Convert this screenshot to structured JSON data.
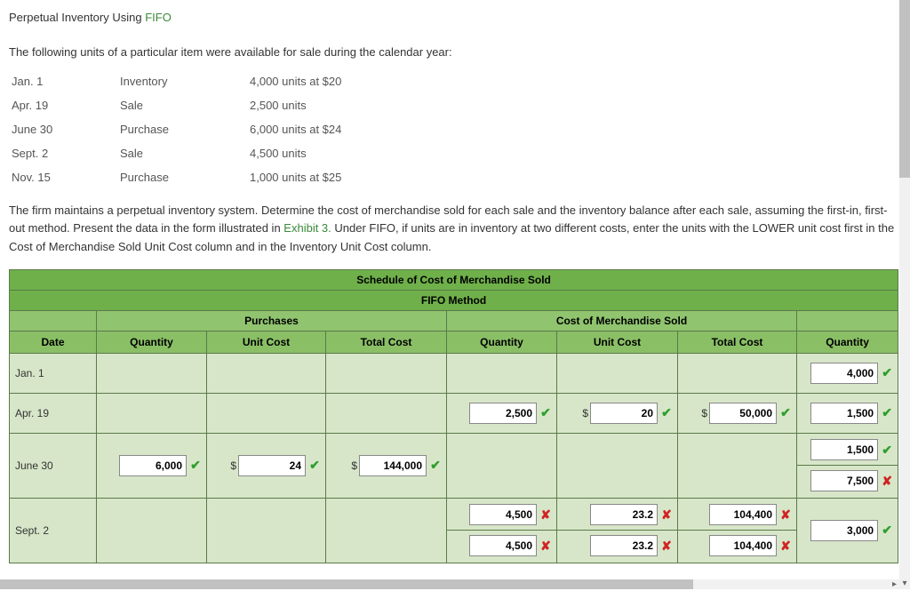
{
  "header": {
    "title_prefix": "Perpetual Inventory Using ",
    "title_link": "FIFO"
  },
  "intro": "The following units of a particular item were available for sale during the calendar year:",
  "transactions": [
    {
      "date": "Jan. 1",
      "type": "Inventory",
      "desc": "4,000 units at $20"
    },
    {
      "date": "Apr. 19",
      "type": "Sale",
      "desc": "2,500 units"
    },
    {
      "date": "June 30",
      "type": "Purchase",
      "desc": "6,000 units at $24"
    },
    {
      "date": "Sept. 2",
      "type": "Sale",
      "desc": "4,500 units"
    },
    {
      "date": "Nov. 15",
      "type": "Purchase",
      "desc": "1,000 units at $25"
    }
  ],
  "instr": {
    "p1a": "The firm maintains a perpetual inventory system. Determine the cost of merchandise sold for each sale and the inventory balance after each sale, assuming the first-in, first-out method. Present the data in the form illustrated in ",
    "link": "Exhibit 3.",
    "p1b": " Under FIFO, if units are in inventory at two different costs, enter the units with the LOWER unit cost first in the Cost of Merchandise Sold Unit Cost column and in the Inventory Unit Cost column."
  },
  "ws": {
    "title": "Schedule of Cost of Merchandise Sold",
    "subtitle": "FIFO Method",
    "grp_purchases": "Purchases",
    "grp_cogs": "Cost of Merchandise Sold",
    "cols": {
      "date": "Date",
      "qty": "Quantity",
      "uc": "Unit Cost",
      "tc": "Total Cost",
      "qty2": "Quantity",
      "uc2": "Unit Cost",
      "tc2": "Total Cost",
      "qty3": "Quantity"
    },
    "rows": {
      "r0": {
        "date": "Jan. 1",
        "inv_q": "4,000",
        "inv_q_ok": true
      },
      "r1": {
        "date": "Apr. 19",
        "cq": "2,500",
        "cq_ok": true,
        "cuc": "20",
        "cuc_ok": true,
        "ctc": "50,000",
        "ctc_ok": true,
        "inv_q": "1,500",
        "inv_q_ok": true
      },
      "r2": {
        "date": "June 30",
        "pq": "6,000",
        "pq_ok": true,
        "puc": "24",
        "puc_ok": true,
        "ptc": "144,000",
        "ptc_ok": true,
        "inv_a_q": "1,500",
        "inv_a_ok": true,
        "inv_b_q": "7,500",
        "inv_b_ok": false
      },
      "r3": {
        "date": "Sept. 2",
        "a": {
          "cq": "4,500",
          "cq_ok": false,
          "cuc": "23.2",
          "cuc_ok": false,
          "ctc": "104,400",
          "ctc_ok": false
        },
        "b": {
          "cq": "4,500",
          "cq_ok": false,
          "cuc": "23.2",
          "cuc_ok": false,
          "ctc": "104,400",
          "ctc_ok": false
        },
        "inv_q": "3,000",
        "inv_q_ok": true
      }
    }
  },
  "glyph": {
    "dollar": "$",
    "check": "✔",
    "cross": "✘",
    "right": "▸",
    "down": "▾"
  }
}
